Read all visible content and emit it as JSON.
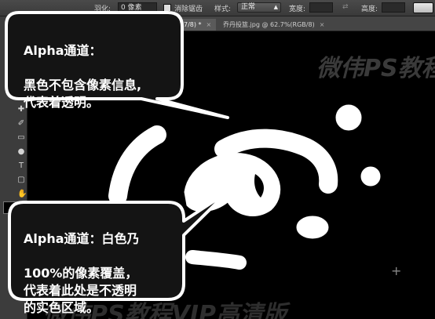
{
  "options_bar": {
    "feather_label": "羽化:",
    "feather_value": "0 像素",
    "antialias_label": "消除锯齿",
    "style_label": "样式:",
    "style_value": "正常",
    "width_label": "宽度:",
    "height_label": "高度:"
  },
  "tabs": [
    {
      "label": "7/8) *",
      "close": "×",
      "active": true
    },
    {
      "label": "乔丹投篮.jpg @ 62.7%(RGB/8)",
      "close": "×",
      "active": false
    }
  ],
  "canvas": {
    "background": "#000000",
    "watermark_top": "微伟PS教程",
    "watermark_bottom": "微伟PS教程VIP高清版"
  },
  "callouts": [
    {
      "title": "Alpha通道：",
      "body": "黑色不包含像素信息,\n代表着透明。"
    },
    {
      "title": "Alpha通道：白色乃",
      "body": "100%的像素覆盖，\n代表着此处是不透明\n的实色区域。"
    }
  ],
  "tools": [
    "move-tool",
    "marquee-tool",
    "lasso-tool",
    "quick-select-tool",
    "crop-tool",
    "eyedropper-tool",
    "healing-tool",
    "brush-tool",
    "stamp-tool",
    "history-brush-tool",
    "eraser-tool",
    "gradient-tool",
    "blur-tool",
    "dodge-tool",
    "pen-tool",
    "type-tool",
    "path-select-tool",
    "shape-tool",
    "hand-tool",
    "zoom-tool"
  ],
  "colors": {
    "accent": "#ffffff",
    "callout_bg": "#111111",
    "callout_border": "#ffffff"
  }
}
